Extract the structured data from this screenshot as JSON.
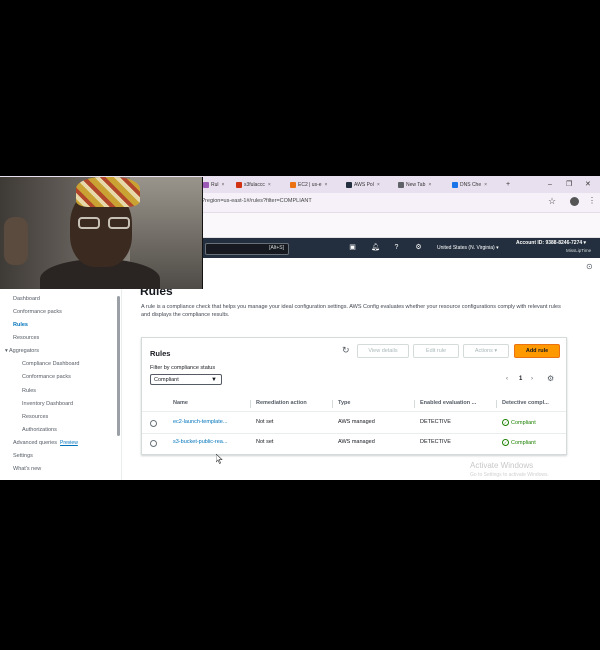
{
  "browser": {
    "tabs": [
      {
        "label": "Rul",
        "color": "#9b59b6"
      },
      {
        "label": "s3fulaccc",
        "color": "#d13212"
      },
      {
        "label": "EC2 | us-e",
        "color": "#ec7211"
      },
      {
        "label": "AWS Pol",
        "color": "#232f3e"
      },
      {
        "label": "New Tab",
        "color": "#5f6368"
      },
      {
        "label": "DNS Che",
        "color": "#1a73e8"
      }
    ],
    "new_tab": "+",
    "url": "?region=us-east-1#/rules?filter=COMPLIANT"
  },
  "aws_header": {
    "search_shortcut": "[Alt+S]",
    "region": "United States (N. Virginia) ▾",
    "account": "Account ID: 9388-8246-7274 ▾",
    "user": "MissLipTime"
  },
  "sidebar": {
    "items": [
      {
        "label": "Dashboard",
        "level": 0
      },
      {
        "label": "Conformance packs",
        "level": 0
      },
      {
        "label": "Rules",
        "level": 0,
        "active": true
      },
      {
        "label": "Resources",
        "level": 0
      },
      {
        "label": "▾ Aggregators",
        "level": 0
      },
      {
        "label": "Compliance Dashboard",
        "level": 1
      },
      {
        "label": "Conformance packs",
        "level": 1
      },
      {
        "label": "Rules",
        "level": 1
      },
      {
        "label": "Inventory Dashboard",
        "level": 1
      },
      {
        "label": "Resources",
        "level": 1
      },
      {
        "label": "Authorizations",
        "level": 1
      },
      {
        "label": "Advanced queries",
        "level": 0,
        "badge": "Preview"
      },
      {
        "label": "Settings",
        "level": 0
      },
      {
        "label": "What's new",
        "level": 0
      }
    ]
  },
  "main": {
    "title": "Rules",
    "description": "A rule is a compliance check that helps you manage your ideal configuration settings. AWS Config evaluates whether your resource configurations comply with relevant rules and displays the compliance results."
  },
  "rules_panel": {
    "title": "Rules",
    "buttons": {
      "view_details": "View details",
      "edit_rule": "Edit rule",
      "actions": "Actions ▾",
      "add_rule": "Add rule"
    },
    "filter_label": "Filter by compliance status",
    "filter_value": "Compliant",
    "page": "1",
    "columns": [
      "Name",
      "Remediation action",
      "Type",
      "Enabled evaluation ...",
      "Detective compl..."
    ],
    "rows": [
      {
        "name": "ec2-launch-template...",
        "remediation": "Not set",
        "type": "AWS managed",
        "evaluation": "DETECTIVE",
        "compliance": "Compliant"
      },
      {
        "name": "s3-bucket-public-rea...",
        "remediation": "Not set",
        "type": "AWS managed",
        "evaluation": "DETECTIVE",
        "compliance": "Compliant"
      }
    ]
  },
  "watermark": {
    "line1": "Activate Windows",
    "line2": "Go to Settings to activate Windows."
  },
  "colors": {
    "aws_header": "#232f3e",
    "primary_button": "#ff9900",
    "link": "#0073bb",
    "compliant": "#1d8102"
  }
}
